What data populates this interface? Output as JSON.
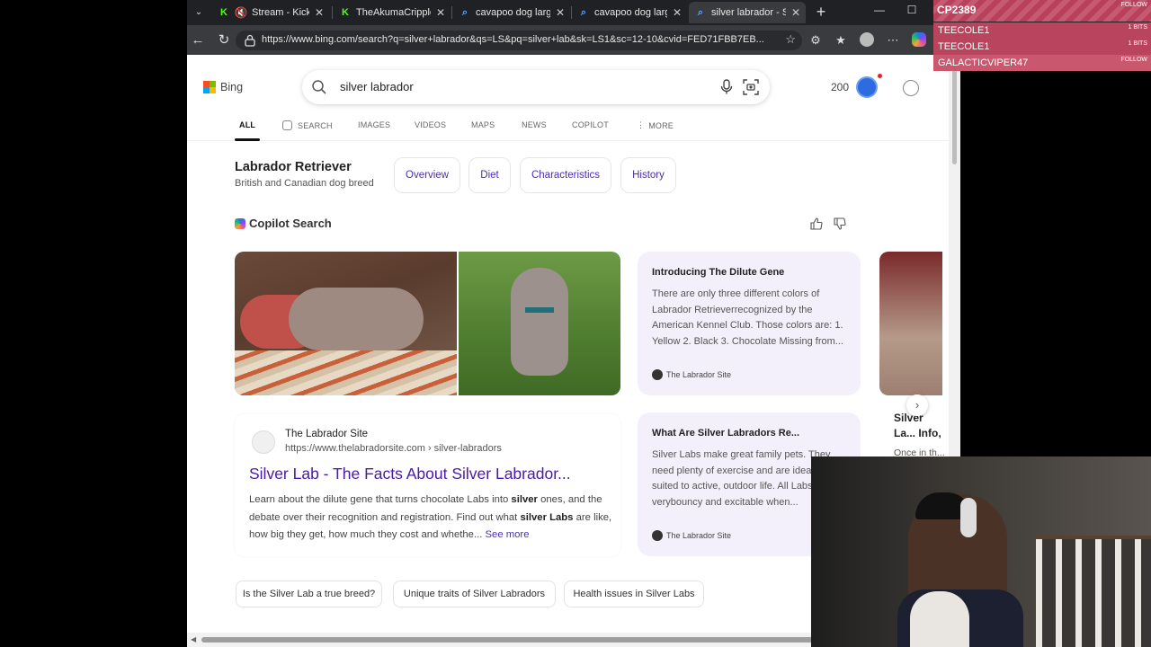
{
  "browser": {
    "tabs": [
      {
        "title": "Stream - Kick Da",
        "favicon": "speaker-muted-icon",
        "active": false
      },
      {
        "title": "TheAkumaCrippled",
        "favicon": "kick-logo",
        "active": false
      },
      {
        "title": "cavapoo dog large",
        "favicon": "bing-search-icon",
        "active": false
      },
      {
        "title": "cavapoo dog large",
        "favicon": "bing-search-icon",
        "active": false
      },
      {
        "title": "silver labrador - Sea",
        "favicon": "bing-search-icon",
        "active": true
      }
    ],
    "url": "https://www.bing.com/search?q=silver+labrador&qs=LS&pq=silver+lab&sk=LS1&sc=12-10&cvid=FED71FBB7EB..."
  },
  "bing": {
    "logo_text": "Bing",
    "search_query": "silver labrador",
    "rewards_points": "200",
    "nav_tabs": [
      "ALL",
      "SEARCH",
      "IMAGES",
      "VIDEOS",
      "MAPS",
      "NEWS",
      "COPILOT",
      "MORE"
    ]
  },
  "entity": {
    "title": "Labrador Retriever",
    "subtitle": "British and Canadian dog breed",
    "pills": [
      "Overview",
      "Diet",
      "Characteristics",
      "History"
    ]
  },
  "copilot": {
    "label": "Copilot Search",
    "cards": [
      {
        "title": "Introducing The Dilute Gene",
        "body": "There are only three different colors of Labrador Retrieverrecognized by the American Kennel Club. Those colors are: 1. Yellow 2. Black 3. Chocolate Missing from...",
        "source": "The Labrador Site"
      },
      {
        "title": "What Are Silver Labradors Re...",
        "body": "Silver Labs make great family pets. They need plenty of exercise and are ideally suited to active, outdoor life. All Labs can be verybouncy and excitable when...",
        "source": "The Labrador Site"
      }
    ],
    "partial_card": {
      "title": "Silver La... Info, Pic...",
      "body": "Once in th..."
    }
  },
  "result": {
    "site_name": "The Labrador Site",
    "site_url": "https://www.thelabradorsite.com › silver-labradors",
    "title": "Silver Lab - The Facts About Silver Labrador...",
    "snippet_a": "Learn about the dilute gene that turns chocolate Labs into ",
    "snippet_b1": "silver",
    "snippet_c": " ones, and the debate over their recognition and registration. Find out what ",
    "snippet_b2": "silver Labs",
    "snippet_d": " are like, how big they get, how much they cost and whethe...",
    "see_more": "See more"
  },
  "related_chips": [
    "Is the Silver Lab a true breed?",
    "Unique traits of Silver Labradors",
    "Health issues in Silver Labs"
  ],
  "stream_alerts": [
    {
      "name": "CP2389",
      "right": "FOLLOW"
    },
    {
      "name": "TEECOLE1",
      "right": "1 BITS"
    },
    {
      "name": "TEECOLE1",
      "right": "1 BITS"
    },
    {
      "name": "GALACTICVIPER47",
      "right": "FOLLOW"
    }
  ]
}
